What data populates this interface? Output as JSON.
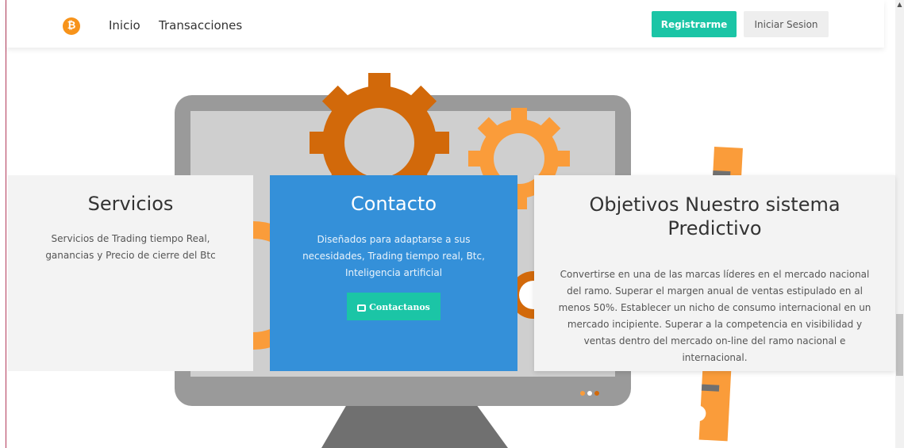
{
  "navbar": {
    "logo_icon": "bitcoin-icon",
    "logo_glyph": "₿",
    "links": [
      "Inicio",
      "Transacciones"
    ],
    "register_label": "Registrarme",
    "login_label": "Iniciar Sesion"
  },
  "cards": {
    "services": {
      "title": "Servicios",
      "text": "Servicios de Trading tiempo Real, ganancias y Precio de cierre del Btc"
    },
    "contact": {
      "title": "Contacto",
      "text": "Diseñados para adaptarse a sus necesidades, Trading tiempo real, Btc, Inteligencia artificial",
      "button_label": "Contactanos",
      "button_icon": "envelope-icon"
    },
    "goals": {
      "title": "Objetivos Nuestro sistema Predictivo",
      "text": "Convertirse en una de las marcas líderes en el mercado nacional del ramo. Superar el margen anual de ventas estipulado en al menos 50%. Establecer un nicho de consumo internacional en un mercado incipiente. Superar a la competencia en visibilidad y ventas dentro del mercado on-line del ramo nacional e internacional."
    }
  },
  "colors": {
    "accent": "#1bc5a6",
    "contact_bg": "#3490d9",
    "gear_dark": "#d2690a",
    "gear_light": "#fa9c3a",
    "monitor": "#9a9a9a"
  }
}
